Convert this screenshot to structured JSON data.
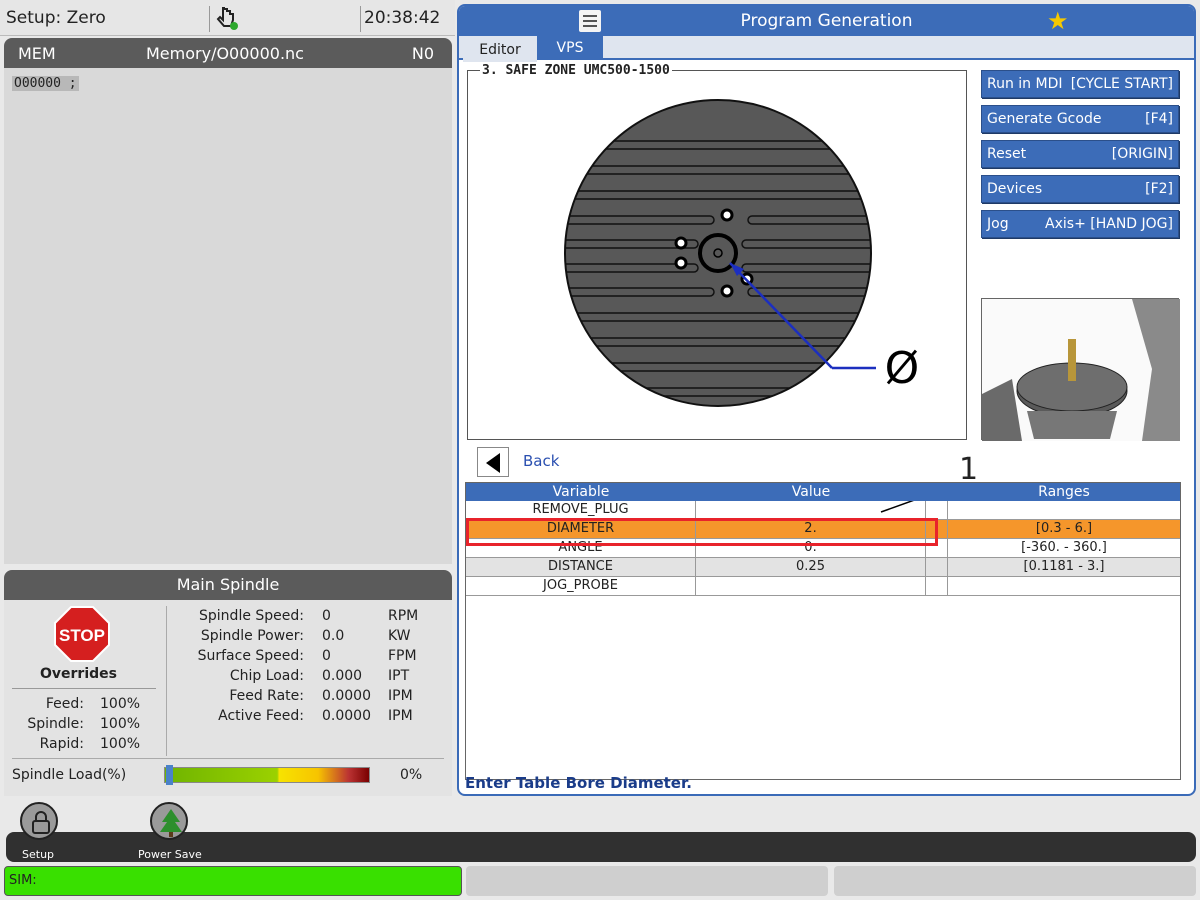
{
  "status": {
    "setup_mode": "Setup: Zero",
    "clock": "20:38:42"
  },
  "memory": {
    "mode": "MEM",
    "file": "Memory/O00000.nc",
    "n": "N0",
    "program_line": "O00000 ;"
  },
  "spindle": {
    "title": "Main Spindle",
    "stop_label": "STOP",
    "overrides_title": "Overrides",
    "overrides": [
      {
        "label": "Feed:",
        "value": "100%"
      },
      {
        "label": "Spindle:",
        "value": "100%"
      },
      {
        "label": "Rapid:",
        "value": "100%"
      }
    ],
    "stats": [
      {
        "label": "Spindle Speed:",
        "value": "0",
        "unit": "RPM"
      },
      {
        "label": "Spindle Power:",
        "value": "0.0",
        "unit": "KW"
      },
      {
        "label": "Surface Speed:",
        "value": "0",
        "unit": "FPM"
      },
      {
        "label": "Chip Load:",
        "value": "0.000",
        "unit": "IPT"
      },
      {
        "label": "Feed Rate:",
        "value": "0.0000",
        "unit": "IPM"
      },
      {
        "label": "Active Feed:",
        "value": "0.0000",
        "unit": "IPM"
      }
    ],
    "load_label": "Spindle Load(%)",
    "load_value": "0%",
    "load_fraction": 0
  },
  "program_gen": {
    "title": "Program Generation",
    "tabs": [
      "Editor",
      "VPS"
    ],
    "active_tab": "VPS",
    "diagram_title": "3. SAFE ZONE UMC500-1500",
    "diameter_symbol": "Ø",
    "buttons": [
      {
        "label": "Run in MDI",
        "key": "[CYCLE START]"
      },
      {
        "label": "Generate Gcode",
        "key": "[F4]"
      },
      {
        "label": "Reset",
        "key": "[ORIGIN]"
      },
      {
        "label": "Devices",
        "key": "[F2]"
      },
      {
        "label": "Jog",
        "key": "Axis+ [HAND JOG]"
      }
    ],
    "back_label": "Back",
    "callout": "1",
    "table": {
      "headers": [
        "Variable",
        "Value",
        "",
        "Ranges"
      ],
      "rows": [
        {
          "variable": "REMOVE_PLUG",
          "value": "",
          "range": ""
        },
        {
          "variable": "DIAMETER",
          "value": "2.",
          "range": "[0.3 - 6.]"
        },
        {
          "variable": "ANGLE",
          "value": "0.",
          "range": "[-360. - 360.]"
        },
        {
          "variable": "DISTANCE",
          "value": "0.25",
          "range": "[0.1181 - 3.]"
        },
        {
          "variable": "JOG_PROBE",
          "value": "",
          "range": ""
        }
      ],
      "selected_row": 1
    },
    "prompt": "Enter Table Bore Diameter."
  },
  "dock": {
    "items": [
      {
        "label": "Setup",
        "icon": "lock-icon"
      },
      {
        "label": "Power Save",
        "icon": "tree-icon"
      }
    ]
  },
  "statusbar": {
    "sim_label": "SIM:"
  },
  "colors": {
    "accent": "#3c6cb8",
    "selected_row": "#f5962b",
    "sim_green": "#39e000",
    "highlight_outline": "#e8232b"
  }
}
